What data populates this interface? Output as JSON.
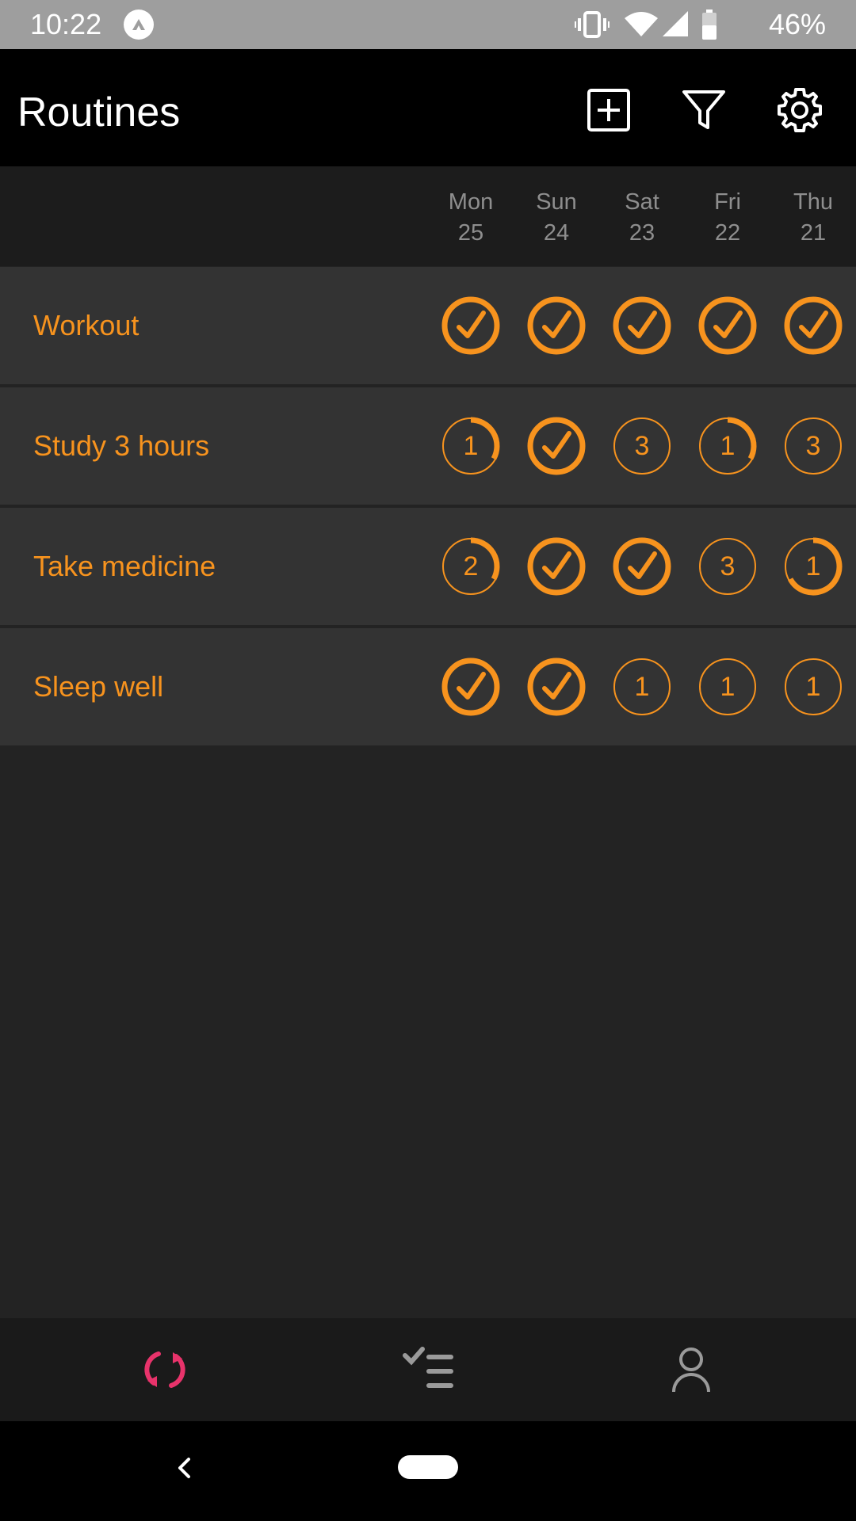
{
  "status_bar": {
    "time": "10:22",
    "battery_percent": "46%",
    "icons": [
      "app-notification-icon",
      "vibrate-icon",
      "wifi-icon",
      "cell-signal-icon",
      "battery-icon"
    ]
  },
  "app_bar": {
    "title": "Routines",
    "actions": [
      "add-icon",
      "filter-icon",
      "gear-icon"
    ]
  },
  "accent_color": "#f7931e",
  "days": [
    {
      "dow": "Mon",
      "date": "25"
    },
    {
      "dow": "Sun",
      "date": "24"
    },
    {
      "dow": "Sat",
      "date": "23"
    },
    {
      "dow": "Fri",
      "date": "22"
    },
    {
      "dow": "Thu",
      "date": "21"
    }
  ],
  "routines": [
    {
      "name": "Workout",
      "cells": [
        {
          "done": true
        },
        {
          "done": true
        },
        {
          "done": true
        },
        {
          "done": true
        },
        {
          "done": true
        }
      ]
    },
    {
      "name": "Study 3 hours",
      "cells": [
        {
          "done": false,
          "count": "1",
          "progress": 0.33
        },
        {
          "done": true
        },
        {
          "done": false,
          "count": "3",
          "progress": 0
        },
        {
          "done": false,
          "count": "1",
          "progress": 0.33
        },
        {
          "done": false,
          "count": "3",
          "progress": 0
        }
      ]
    },
    {
      "name": "Take medicine",
      "cells": [
        {
          "done": false,
          "count": "2",
          "progress": 0.33
        },
        {
          "done": true
        },
        {
          "done": true
        },
        {
          "done": false,
          "count": "3",
          "progress": 0
        },
        {
          "done": false,
          "count": "1",
          "progress": 0.67
        }
      ]
    },
    {
      "name": "Sleep well",
      "cells": [
        {
          "done": true
        },
        {
          "done": true
        },
        {
          "done": false,
          "count": "1",
          "progress": 0
        },
        {
          "done": false,
          "count": "1",
          "progress": 0
        },
        {
          "done": false,
          "count": "1",
          "progress": 0
        }
      ]
    }
  ],
  "bottom_nav": {
    "items": [
      "routines-sync-icon",
      "checklist-icon",
      "profile-icon"
    ],
    "active": "routines-sync-icon",
    "active_color": "#e8336b",
    "inactive_color": "#9a9a9a"
  },
  "system_nav": [
    "back-icon",
    "home-pill"
  ]
}
